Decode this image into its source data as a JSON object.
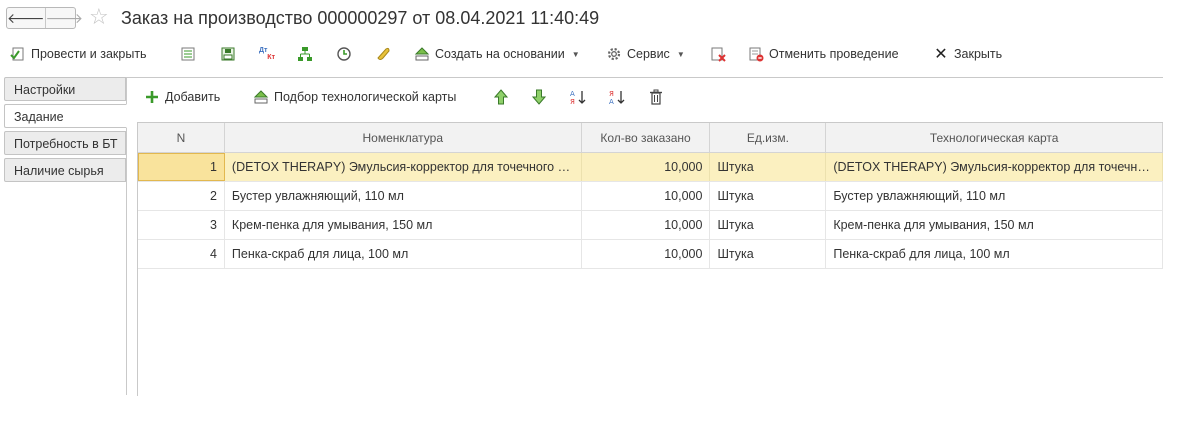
{
  "window": {
    "title": "Заказ на производство 000000297 от 08.04.2021 11:40:49",
    "back_glyph": "🡐",
    "forward_glyph": "🡒",
    "star_glyph": "☆"
  },
  "commandbar": {
    "post_close_label": "Провести и закрыть",
    "create_based_label": "Создать на основании",
    "service_label": "Сервис",
    "cancel_posting_label": "Отменить проведение",
    "close_label": "Закрыть",
    "dt_kt_top": "Дт",
    "dt_kt_bottom": "Кт"
  },
  "sidetabs": [
    {
      "label": "Настройки"
    },
    {
      "label": "Задание"
    },
    {
      "label": "Потребность в БТ"
    },
    {
      "label": "Наличие сырья"
    }
  ],
  "table_toolbar": {
    "add_label": "Добавить",
    "pick_tech_card_label": "Подбор технологической карты"
  },
  "grid": {
    "columns": [
      "N",
      "Номенклатура",
      "Кол-во заказано",
      "Ед.изм.",
      "Технологическая карта"
    ],
    "rows": [
      {
        "n": "1",
        "item": "(DETOX THERAPY) Эмульсия-корректор для точечного применения",
        "qty": "10,000",
        "unit": "Штука",
        "card": "(DETOX THERAPY) Эмульсия-корректор для точечного применения"
      },
      {
        "n": "2",
        "item": "Бустер увлажняющий, 110 мл",
        "qty": "10,000",
        "unit": "Штука",
        "card": "Бустер увлажняющий, 110 мл"
      },
      {
        "n": "3",
        "item": "Крем-пенка для умывания, 150 мл",
        "qty": "10,000",
        "unit": "Штука",
        "card": "Крем-пенка для умывания, 150 мл"
      },
      {
        "n": "4",
        "item": "Пенка-скраб для лица, 100 мл",
        "qty": "10,000",
        "unit": "Штука",
        "card": "Пенка-скраб для лица, 100 мл"
      }
    ]
  },
  "colors": {
    "accent_green": "#3a9a2a",
    "selected_row": "#fbf0c0",
    "selected_cell": "#f9e39c"
  }
}
